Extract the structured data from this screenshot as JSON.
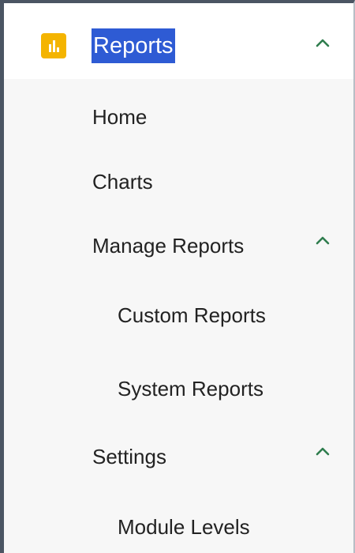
{
  "header": {
    "icon": "bar-chart-icon",
    "title": "Reports",
    "expanded": true
  },
  "nav": {
    "home": "Home",
    "charts": "Charts",
    "manage_reports": "Manage Reports",
    "custom_reports": "Custom Reports",
    "system_reports": "System Reports",
    "settings": "Settings",
    "module_levels": "Module Levels"
  },
  "colors": {
    "accent_icon": "#f4b400",
    "selection_highlight": "#2e5bd4",
    "chevron": "#2f7d4e",
    "panel_background": "#f7f7f7"
  }
}
